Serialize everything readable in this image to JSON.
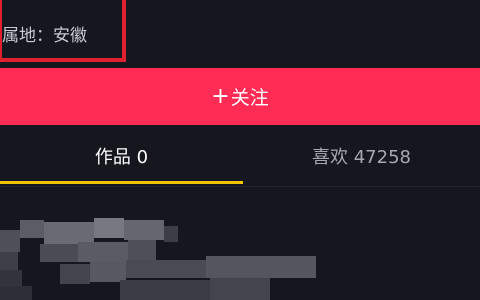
{
  "profile": {
    "location_text": "属地：安徽"
  },
  "actions": {
    "follow_label": "关注",
    "follow_icon": "plus-icon"
  },
  "tabs": [
    {
      "label": "作品 0",
      "active": true
    },
    {
      "label": "喜欢 47258",
      "active": false
    }
  ],
  "colors": {
    "background": "#16161f",
    "follow_button": "#fe2c55",
    "highlight_box": "#e0202e",
    "tab_underline": "#f3c400"
  }
}
